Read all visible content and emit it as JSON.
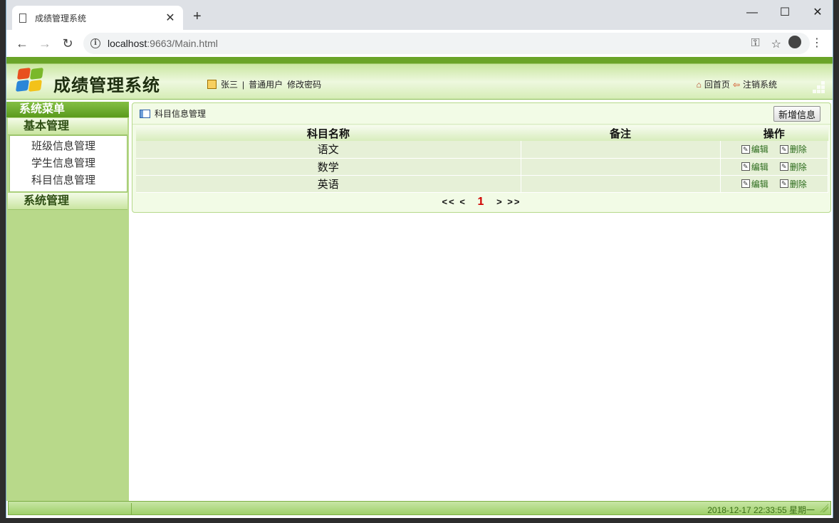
{
  "browser": {
    "tab_title": "成绩管理系统",
    "tab_close": "✕",
    "new_tab": "+",
    "url_host": "localhost",
    "url_rest": ":9663/Main.html",
    "controls": {
      "minimize": "—",
      "maximize": "☐",
      "close": "✕"
    }
  },
  "app": {
    "title": "成绩管理系统",
    "user_name": "张三",
    "separator": "|",
    "role": "普通用户",
    "change_password": "修改密码",
    "home": "回首页",
    "logout": "注销系统"
  },
  "sidebar": {
    "menu_title": "系统菜单",
    "groups": [
      {
        "label": "基本管理",
        "items": [
          "班级信息管理",
          "学生信息管理",
          "科目信息管理"
        ]
      },
      {
        "label": "系统管理",
        "items": []
      }
    ]
  },
  "main": {
    "panel_title": "科目信息管理",
    "add_button": "新增信息",
    "columns": [
      "科目名称",
      "备注",
      "操作"
    ],
    "rows": [
      {
        "name": "语文",
        "remark": ""
      },
      {
        "name": "数学",
        "remark": ""
      },
      {
        "name": "英语",
        "remark": ""
      }
    ],
    "edit_label": "编辑",
    "delete_label": "删除",
    "pager": {
      "first": "<<",
      "prev": "<",
      "current": "1",
      "next": ">",
      "last": ">>"
    }
  },
  "footer": {
    "datetime": "2018-12-17 22:33:55 星期一"
  }
}
